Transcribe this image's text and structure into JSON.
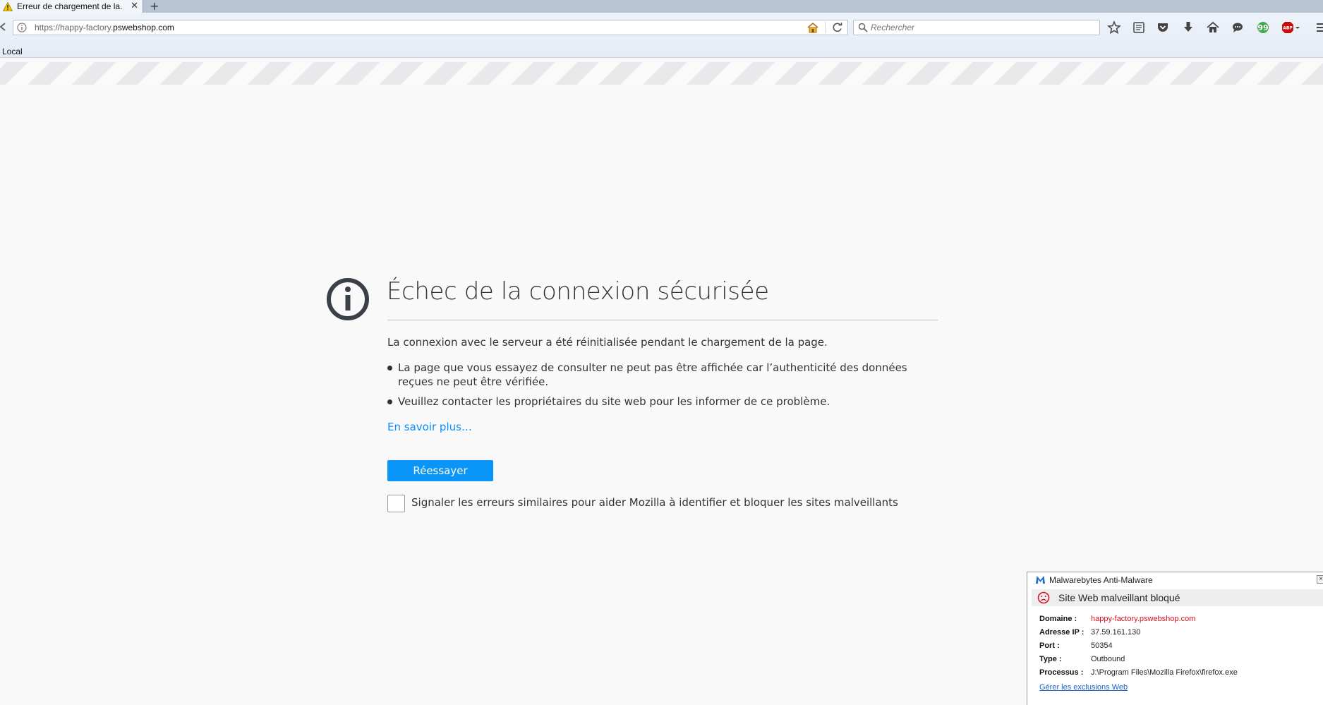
{
  "browser": {
    "tab_title": "Erreur de chargement de la...",
    "url_prefix": "https://happy-factory.",
    "url_domain": "pswebshop.com",
    "search_placeholder": "Rechercher",
    "bookmarks_item": "Local",
    "toolbar_icons": [
      "star-icon",
      "reading-list-icon",
      "pocket-icon",
      "download-icon",
      "home-icon",
      "chat-icon",
      "green-quote-icon",
      "adblock-plus-icon",
      "menu-icon"
    ]
  },
  "error": {
    "title": "Échec de la connexion sécurisée",
    "intro": "La connexion avec le serveur a été réinitialisée pendant le chargement de la page.",
    "bullets": [
      "La page que vous essayez de consulter ne peut pas être affichée car l’authenticité des données reçues ne peut être vérifiée.",
      "Veuillez contacter les propriétaires du site web pour les informer de ce problème."
    ],
    "learn_more": "En savoir plus…",
    "retry_label": "Réessayer",
    "report_label": "Signaler les erreurs similaires pour aider Mozilla à identifier et bloquer les sites malveillants"
  },
  "malwarebytes": {
    "app_name": "Malwarebytes Anti-Malware",
    "message": "Site Web malveillant bloqué",
    "rows": [
      {
        "key": "Domaine :",
        "value": "happy-factory.pswebshop.com"
      },
      {
        "key": "Adresse IP :",
        "value": "37.59.161.130"
      },
      {
        "key": "Port :",
        "value": "50354"
      },
      {
        "key": "Type :",
        "value": "Outbound"
      },
      {
        "key": "Processus :",
        "value": "J:\\Program Files\\Mozilla Firefox\\firefox.exe"
      }
    ],
    "manage_link": "Gérer les exclusions Web"
  },
  "colors": {
    "accent": "#0996f8",
    "link": "#0a8dff",
    "danger": "#d8101c"
  }
}
